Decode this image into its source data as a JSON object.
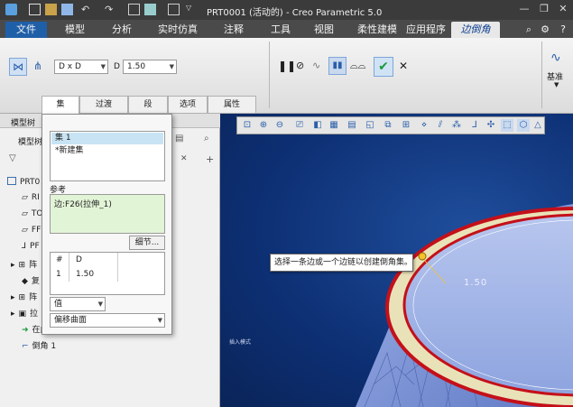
{
  "window": {
    "title": "PRT0001 (活动的) - Creo Parametric 5.0"
  },
  "menu": {
    "tabs": [
      {
        "label": "文件"
      },
      {
        "label": "模型"
      },
      {
        "label": "分析"
      },
      {
        "label": "实时仿真"
      },
      {
        "label": "注释"
      },
      {
        "label": "工具"
      },
      {
        "label": "视图"
      },
      {
        "label": "柔性建模"
      },
      {
        "label": "应用程序"
      },
      {
        "label": "边倒角"
      }
    ],
    "active_tab": "边倒角"
  },
  "ribbon": {
    "profile_select": "D x D",
    "d_label": "D",
    "d_value": "1.50",
    "base_label": "基准"
  },
  "ribbon_tabs": [
    {
      "label": "集"
    },
    {
      "label": "过渡"
    },
    {
      "label": "段"
    },
    {
      "label": "选项"
    },
    {
      "label": "属性"
    }
  ],
  "sets_panel": {
    "sets": [
      {
        "label": "集 1"
      },
      {
        "label": "*新建集"
      }
    ],
    "reference_label": "参考",
    "reference_value": "边:F26(拉伸_1)",
    "detail_button": "细节...",
    "table_headers": [
      "#",
      "D"
    ],
    "table_row": [
      "1",
      "1.50"
    ],
    "value_select": "值",
    "offset_select": "偏移曲面"
  },
  "left_pane": {
    "title": "模型树",
    "tab_label": "模型树",
    "items": [
      {
        "label": "PRT0"
      },
      {
        "label": "RI"
      },
      {
        "label": "TO"
      },
      {
        "label": "FF"
      },
      {
        "label": "PF"
      },
      {
        "label": "阵"
      },
      {
        "label": "复"
      },
      {
        "label": "阵"
      },
      {
        "label": "拉"
      },
      {
        "label": "在此插入"
      },
      {
        "label": "倒角 1"
      }
    ]
  },
  "viewport": {
    "tooltip": "选择一条边或一个边链以创建倒角集。",
    "dimension_label": "1.50",
    "insert_mode": "插入模式"
  }
}
